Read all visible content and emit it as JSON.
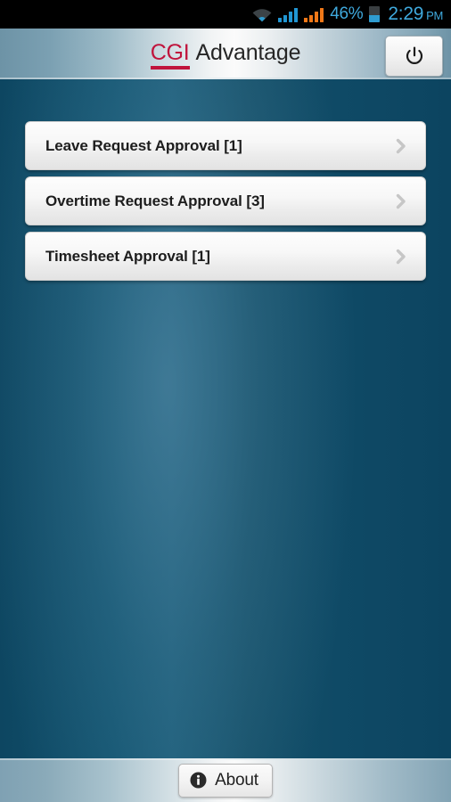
{
  "status_bar": {
    "wifi_icon": "wifi-icon",
    "signal_icon_1": "signal-bars-icon",
    "signal_icon_2": "signal-bars-icon",
    "battery_percent": "46%",
    "battery_level": 46,
    "battery_icon": "battery-icon",
    "time": "2:29",
    "meridiem": "PM",
    "colors": {
      "text": "#3fa9dd",
      "signal_1": "#2196d3",
      "signal_2": "#f07818",
      "background": "#000000"
    }
  },
  "header": {
    "brand_primary": "CGI",
    "brand_secondary": "Advantage",
    "power_button_icon": "power-icon",
    "colors": {
      "brand_primary": "#c0143c",
      "brand_secondary": "#262626"
    }
  },
  "main": {
    "rows": [
      {
        "label": "Leave Request Approval [1]",
        "chevron_icon": "chevron-right-icon"
      },
      {
        "label": "Overtime Request Approval [3]",
        "chevron_icon": "chevron-right-icon"
      },
      {
        "label": "Timesheet Approval [1]",
        "chevron_icon": "chevron-right-icon"
      }
    ],
    "background_color": "#12536f"
  },
  "footer": {
    "about_label": "About",
    "about_icon": "info-icon"
  }
}
